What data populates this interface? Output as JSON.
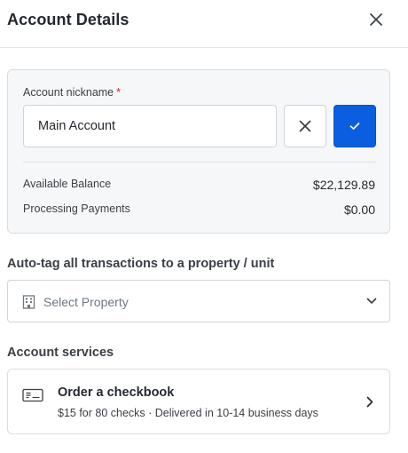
{
  "header": {
    "title": "Account Details",
    "close_icon": "close-icon"
  },
  "nickname": {
    "label": "Account nickname",
    "required_marker": "*",
    "value": "Main Account",
    "clear_icon": "x-icon",
    "confirm_icon": "checkmark-icon"
  },
  "balances": [
    {
      "label": "Available Balance",
      "value": "$22,129.89"
    },
    {
      "label": "Processing Payments",
      "value": "$0.00"
    }
  ],
  "autotag": {
    "title": "Auto-tag all transactions to a property / unit",
    "placeholder": "Select Property",
    "icon": "building-icon",
    "dropdown_icon": "chevron-down-icon"
  },
  "services": {
    "title": "Account services",
    "items": [
      {
        "title": "Order a checkbook",
        "subtitle": "$15 for 80 checks · Delivered in 10-14 business days",
        "icon": "check-icon",
        "arrow_icon": "chevron-right-icon"
      }
    ]
  },
  "colors": {
    "primary": "#0b5ee0",
    "required": "#d1242f",
    "card_bg": "#f6f7f8"
  }
}
